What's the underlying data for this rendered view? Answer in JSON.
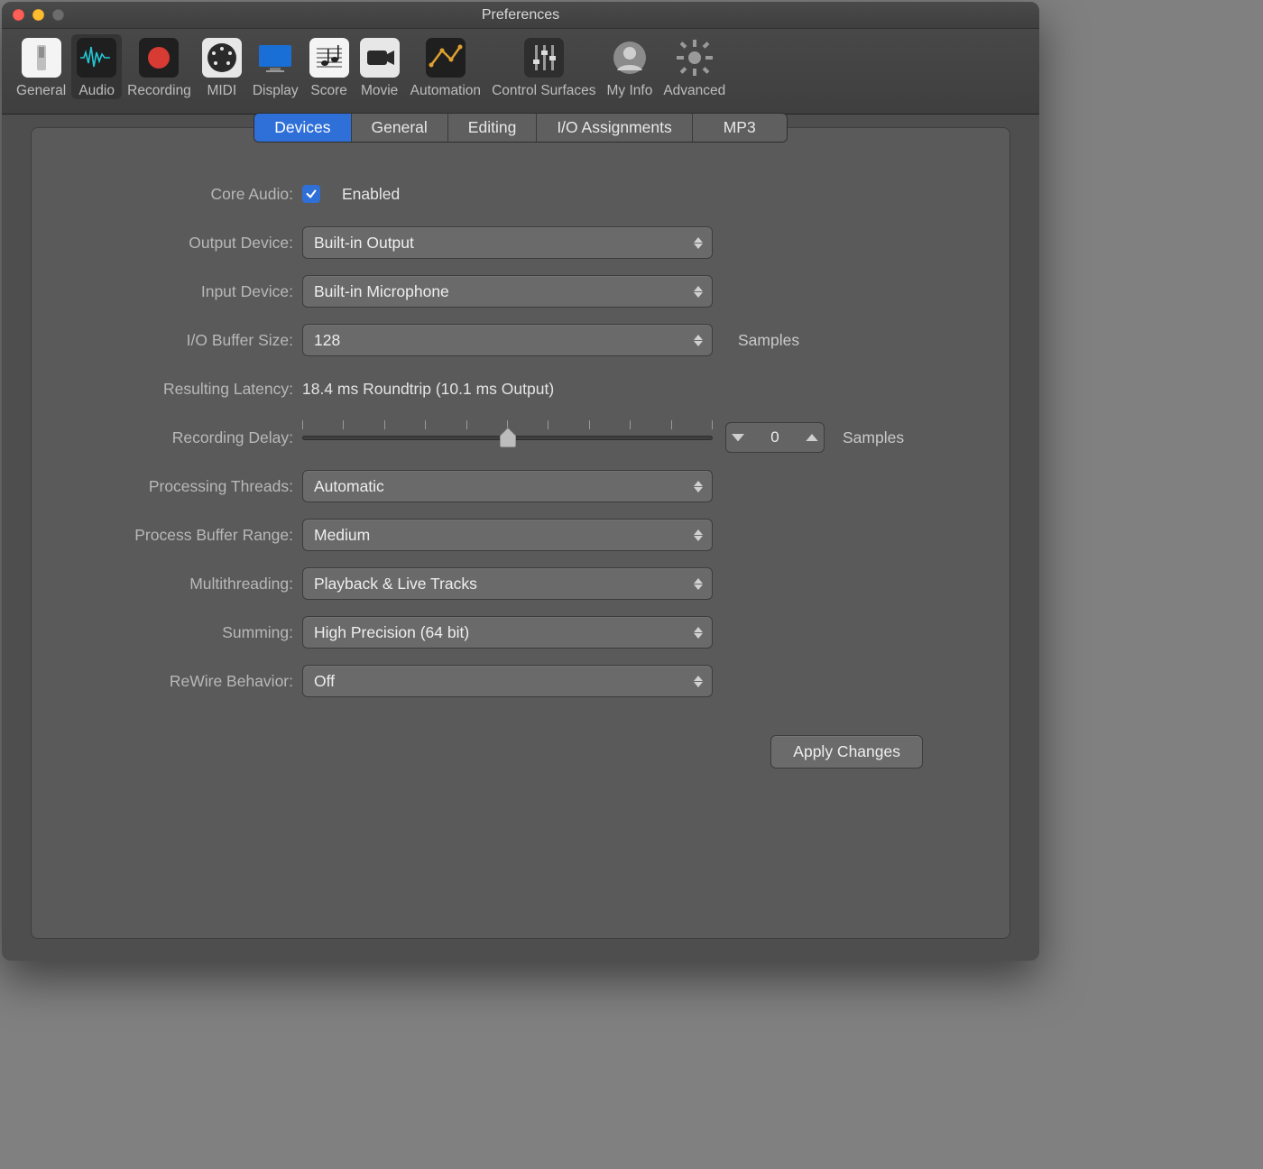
{
  "window": {
    "title": "Preferences"
  },
  "toolbar": {
    "items": [
      {
        "id": "general",
        "label": "General"
      },
      {
        "id": "audio",
        "label": "Audio"
      },
      {
        "id": "recording",
        "label": "Recording"
      },
      {
        "id": "midi",
        "label": "MIDI"
      },
      {
        "id": "display",
        "label": "Display"
      },
      {
        "id": "score",
        "label": "Score"
      },
      {
        "id": "movie",
        "label": "Movie"
      },
      {
        "id": "automation",
        "label": "Automation"
      },
      {
        "id": "control-surfaces",
        "label": "Control Surfaces"
      },
      {
        "id": "my-info",
        "label": "My Info"
      },
      {
        "id": "advanced",
        "label": "Advanced"
      }
    ],
    "selected": "audio"
  },
  "subtabs": {
    "items": [
      {
        "id": "devices",
        "label": "Devices"
      },
      {
        "id": "general",
        "label": "General"
      },
      {
        "id": "editing",
        "label": "Editing"
      },
      {
        "id": "io-assignments",
        "label": "I/O Assignments"
      },
      {
        "id": "mp3",
        "label": "MP3"
      }
    ],
    "active": "devices"
  },
  "labels": {
    "core_audio": "Core Audio:",
    "output_device": "Output Device:",
    "input_device": "Input Device:",
    "io_buffer": "I/O Buffer Size:",
    "resulting_latency": "Resulting Latency:",
    "recording_delay": "Recording Delay:",
    "processing_threads": "Processing Threads:",
    "process_buffer_range": "Process Buffer Range:",
    "multithreading": "Multithreading:",
    "summing": "Summing:",
    "rewire": "ReWire Behavior:",
    "samples": "Samples",
    "enabled": "Enabled"
  },
  "values": {
    "core_audio_enabled": true,
    "output_device": "Built-in Output",
    "input_device": "Built-in Microphone",
    "io_buffer": "128",
    "resulting_latency": "18.4 ms Roundtrip (10.1 ms Output)",
    "recording_delay": "0",
    "processing_threads": "Automatic",
    "process_buffer_range": "Medium",
    "multithreading": "Playback & Live Tracks",
    "summing": "High Precision (64 bit)",
    "rewire": "Off"
  },
  "buttons": {
    "apply": "Apply Changes"
  }
}
